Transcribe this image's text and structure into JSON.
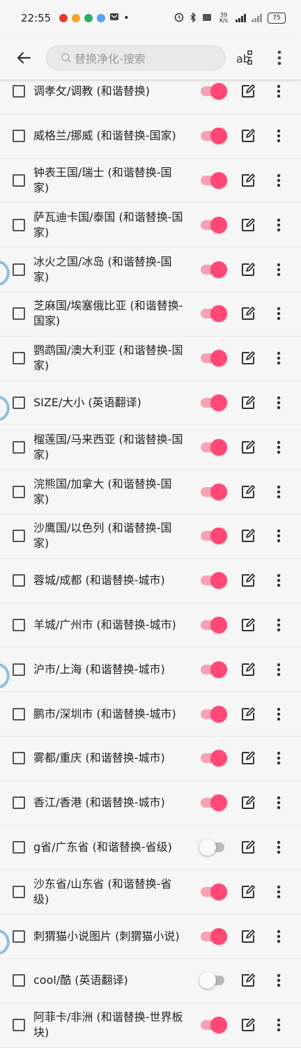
{
  "status_bar": {
    "time": "22:55",
    "network_speed": "39 K/s",
    "battery": "75",
    "app_icon_colors": [
      "#e8392c",
      "#f5a623",
      "#2aae67",
      "#5aa0f0"
    ]
  },
  "toolbar": {
    "search_placeholder": "替换净化-搜索",
    "back_icon": "arrow-left-icon",
    "regex_icon": "regex-icon",
    "more_icon": "more-vert-icon"
  },
  "colors": {
    "accent": "#ff4876",
    "accent_track": "#f7a1b4",
    "off_track": "#b9b9b9"
  },
  "rules": [
    {
      "label": "调孝攵/调教 (和谐替换)",
      "enabled": true
    },
    {
      "label": "威格兰/挪威 (和谐替换-国家)",
      "enabled": true
    },
    {
      "label": "钟表王国/瑞士 (和谐替换-国家)",
      "enabled": true
    },
    {
      "label": "萨瓦迪卡国/泰国 (和谐替换-国家)",
      "enabled": true
    },
    {
      "label": "冰火之国/冰岛 (和谐替换-国家)",
      "enabled": true
    },
    {
      "label": "芝麻国/埃塞俄比亚 (和谐替换-国家)",
      "enabled": true
    },
    {
      "label": "鹦鹉国/澳大利亚 (和谐替换-国家)",
      "enabled": true
    },
    {
      "label": "SIZE/大小 (英语翻译)",
      "enabled": true
    },
    {
      "label": "榴莲国/马来西亚 (和谐替换-国家)",
      "enabled": true
    },
    {
      "label": "浣熊国/加拿大 (和谐替换-国家)",
      "enabled": true
    },
    {
      "label": "沙鹰国/以色列 (和谐替换-国家)",
      "enabled": true
    },
    {
      "label": "蓉城/成都 (和谐替换-城市)",
      "enabled": true
    },
    {
      "label": "羊城/广州市 (和谐替换-城市)",
      "enabled": true
    },
    {
      "label": "沪市/上海 (和谐替换-城市)",
      "enabled": true
    },
    {
      "label": "鹏市/深圳市 (和谐替换-城市)",
      "enabled": true
    },
    {
      "label": "雾都/重庆 (和谐替换-城市)",
      "enabled": true
    },
    {
      "label": "香江/香港 (和谐替换-城市)",
      "enabled": true
    },
    {
      "label": "g省/广东省 (和谐替换-省级)",
      "enabled": false
    },
    {
      "label": "沙东省/山东省 (和谐替换-省级)",
      "enabled": true
    },
    {
      "label": "刺猬猫小说图片 (刺猬猫小说)",
      "enabled": true
    },
    {
      "label": "cool/酷 (英语翻译)",
      "enabled": false
    },
    {
      "label": "阿菲卡/非洲 (和谐替换-世界板块)",
      "enabled": true
    }
  ]
}
